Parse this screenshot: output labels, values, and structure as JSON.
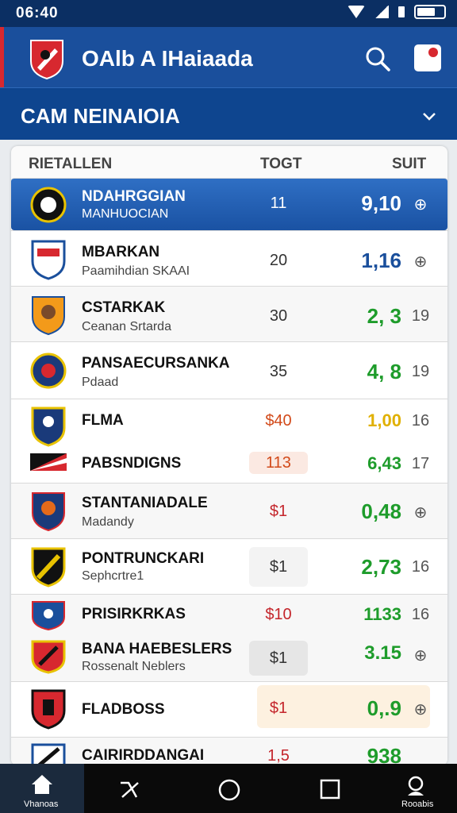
{
  "status": {
    "time": "06:40"
  },
  "app": {
    "title": "OAlb A IHaiaada"
  },
  "section": {
    "title": "CAM NEINAIOIA"
  },
  "columns": {
    "team": "RIETALLEN",
    "total": "TOGT",
    "score": "SUIT"
  },
  "rows": [
    {
      "name": "NDAHRGGIAN",
      "sub": "MANHUOCIAN",
      "total": "11",
      "score": "9,10",
      "extra": "⊕",
      "score_color": "#ffffff",
      "total_color": "#ffffff",
      "highlight": true
    },
    {
      "name": "MBARKAN",
      "sub": "Paamihdian SKAAI",
      "total": "20",
      "score": "1,16",
      "extra": "⊕",
      "score_color": "#1a4f9c",
      "total_color": "#333333"
    },
    {
      "name": "CSTARKAK",
      "sub": "Ceanan Srtarda",
      "total": "30",
      "score": "2, 3",
      "extra": "19",
      "score_color": "#1e9c2b",
      "total_color": "#333333"
    },
    {
      "name": "PANSAECURSANKA",
      "sub": "Pdaad",
      "total": "35",
      "score": "4, 8",
      "extra": "19",
      "score_color": "#1e9c2b",
      "total_color": "#333333"
    },
    {
      "name": "FLMA",
      "sub": "",
      "total": "$40",
      "score": "1,00",
      "extra": "16",
      "score_color": "#e0b000",
      "total_color": "#d24a1a"
    },
    {
      "name": "PABSNDIGNS",
      "sub": "",
      "total": "113",
      "score": "6,43",
      "extra": "17",
      "score_color": "#1e9c2b",
      "total_color": "#d24a1a"
    },
    {
      "name": "STANTANIADALE",
      "sub": "Madandy",
      "total": "$1",
      "score": "0,48",
      "extra": "⊕",
      "score_color": "#1e9c2b",
      "total_color": "#c4252b"
    },
    {
      "name": "PONTRUNCKARI",
      "sub": "Sephcrtre1",
      "total": "$1",
      "score": "2,73",
      "extra": "16",
      "score_color": "#1e9c2b",
      "total_color": "#333333"
    },
    {
      "name": "PRISIRKRKAS",
      "sub": "",
      "total": "$10",
      "score": "1133",
      "extra": "16",
      "score_color": "#1e9c2b",
      "total_color": "#c4252b"
    },
    {
      "name": "BANA HAEBESLERS",
      "sub": "Rossenalt Neblers",
      "total": "$1",
      "score": "3.15",
      "extra": "⊕",
      "score_color": "#1e9c2b",
      "total_color": "#333333"
    },
    {
      "name": "FLADBOSS",
      "sub": "",
      "total": "$1",
      "score": "0,.9",
      "extra": "⊕",
      "score_color": "#1e9c2b",
      "total_color": "#c4252b"
    },
    {
      "name": "CAIRIRDDANGAI",
      "sub": "",
      "total": "1,5",
      "score": "938",
      "extra": "",
      "score_color": "#1e9c2b",
      "total_color": "#c4252b"
    }
  ],
  "nav": {
    "home_label": "Vhanoas",
    "profile_label": "Rooabis"
  },
  "colors": {
    "header": "#1a4f9c",
    "section": "#0e458f",
    "accent_red": "#d7282f"
  }
}
